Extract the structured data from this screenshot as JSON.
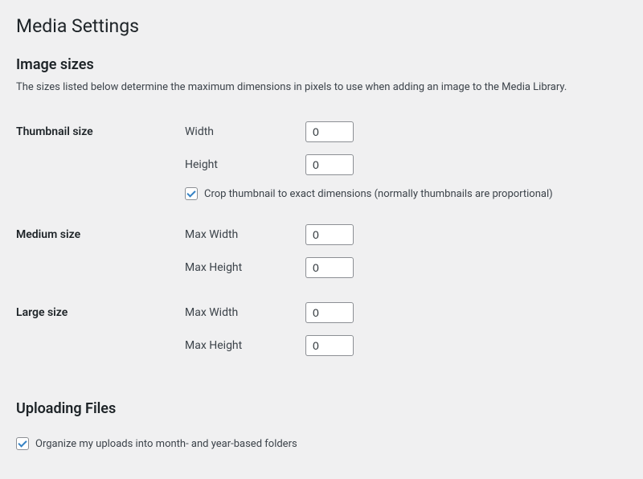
{
  "page_title": "Media Settings",
  "sections": {
    "image_sizes": {
      "heading": "Image sizes",
      "description": "The sizes listed below determine the maximum dimensions in pixels to use when adding an image to the Media Library."
    },
    "uploading_files": {
      "heading": "Uploading Files"
    }
  },
  "thumbnail": {
    "row_label": "Thumbnail size",
    "width_label": "Width",
    "width_value": "0",
    "height_label": "Height",
    "height_value": "0",
    "crop_label": "Crop thumbnail to exact dimensions (normally thumbnails are proportional)",
    "crop_checked": true
  },
  "medium": {
    "row_label": "Medium size",
    "max_width_label": "Max Width",
    "max_width_value": "0",
    "max_height_label": "Max Height",
    "max_height_value": "0"
  },
  "large": {
    "row_label": "Large size",
    "max_width_label": "Max Width",
    "max_width_value": "0",
    "max_height_label": "Max Height",
    "max_height_value": "0"
  },
  "uploads": {
    "organize_label": "Organize my uploads into month- and year-based folders",
    "organize_checked": true
  }
}
